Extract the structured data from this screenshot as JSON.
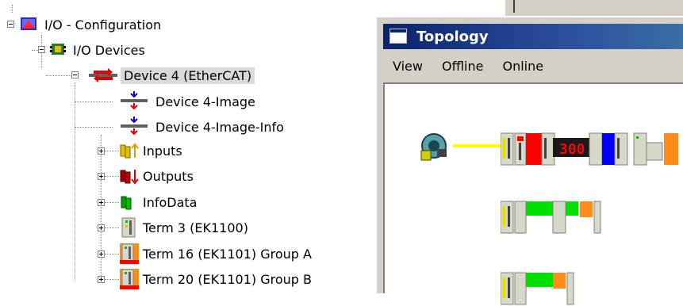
{
  "tree": {
    "root": {
      "label": "I/O - Configuration",
      "icon": "io-config-icon"
    },
    "devices": {
      "label": "I/O Devices",
      "icon": "io-devices-icon"
    },
    "device": {
      "label": "Device 4 (EtherCAT)",
      "icon": "ethercat-device-icon"
    },
    "children": [
      {
        "label": "Device 4-Image",
        "icon": "process-image-icon"
      },
      {
        "label": "Device 4-Image-Info",
        "icon": "process-image-icon"
      },
      {
        "label": "Inputs",
        "icon": "inputs-icon"
      },
      {
        "label": "Outputs",
        "icon": "outputs-icon"
      },
      {
        "label": "InfoData",
        "icon": "infodata-icon"
      },
      {
        "label": "Term 3 (EK1100)",
        "icon": "terminal-icon"
      },
      {
        "label": "Term 16 (EK1101) Group A",
        "icon": "terminal-group-icon"
      },
      {
        "label": "Term 20 (EK1101) Group B",
        "icon": "terminal-group-icon"
      }
    ]
  },
  "topology": {
    "title": "Topology",
    "menu": [
      "View",
      "Offline",
      "Online"
    ],
    "display_value": "300"
  },
  "colors": {
    "title_start": "#0a246a",
    "title_end": "#3a6ea5",
    "selection": "#d9d9d9",
    "terminal_green": "#00e000",
    "terminal_orange": "#ff8c1a",
    "terminal_red": "#ff0000",
    "terminal_blue": "#0000ff",
    "link_yellow": "#ffff00"
  }
}
